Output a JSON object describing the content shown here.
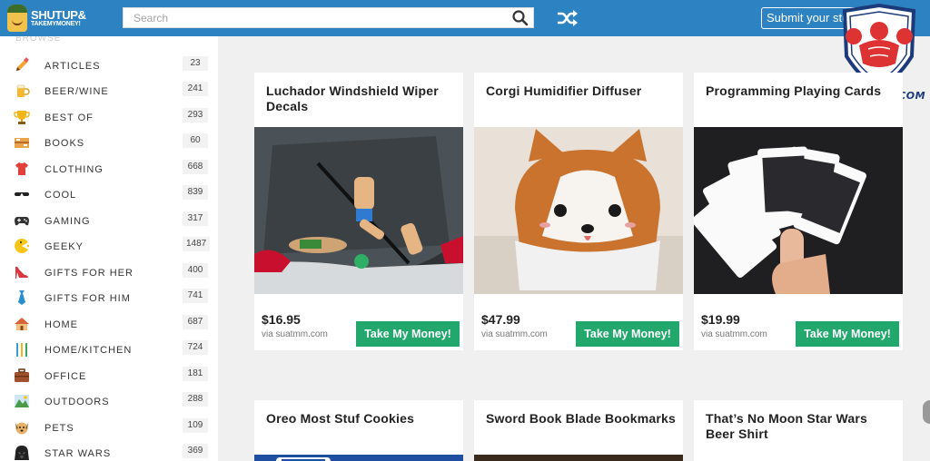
{
  "header": {
    "logo_main": "SHUTUP&",
    "logo_sub": "TAKEMYMONEY!",
    "search_placeholder": "Search",
    "submit_label": "Submit your stuff!"
  },
  "watermark": {
    "text": "GOOWHEE.COM"
  },
  "sidebar": {
    "heading": "BROWSE",
    "categories": [
      {
        "label": "ARTICLES",
        "count": "23",
        "icon": "pencil-icon"
      },
      {
        "label": "BEER/WINE",
        "count": "241",
        "icon": "beer-icon"
      },
      {
        "label": "BEST OF",
        "count": "293",
        "icon": "trophy-icon"
      },
      {
        "label": "BOOKS",
        "count": "60",
        "icon": "books-icon"
      },
      {
        "label": "CLOTHING",
        "count": "668",
        "icon": "shirt-icon"
      },
      {
        "label": "COOL",
        "count": "839",
        "icon": "sunglasses-icon"
      },
      {
        "label": "GAMING",
        "count": "317",
        "icon": "gamepad-icon"
      },
      {
        "label": "GEEKY",
        "count": "1487",
        "icon": "pacman-icon"
      },
      {
        "label": "GIFTS FOR HER",
        "count": "400",
        "icon": "heel-icon"
      },
      {
        "label": "GIFTS FOR HIM",
        "count": "741",
        "icon": "tie-icon"
      },
      {
        "label": "HOME",
        "count": "687",
        "icon": "house-icon"
      },
      {
        "label": "HOME/KITCHEN",
        "count": "724",
        "icon": "utensils-icon"
      },
      {
        "label": "OFFICE",
        "count": "181",
        "icon": "briefcase-icon"
      },
      {
        "label": "OUTDOORS",
        "count": "288",
        "icon": "mountain-icon"
      },
      {
        "label": "PETS",
        "count": "109",
        "icon": "dog-icon"
      },
      {
        "label": "STAR WARS",
        "count": "369",
        "icon": "darth-vader-icon"
      }
    ]
  },
  "products": [
    {
      "title": "Luchador Windshield Wiper Decals",
      "price": "$16.95",
      "via": "via suatmm.com",
      "buy_label": "Take My Money!"
    },
    {
      "title": "Corgi Humidifier Diffuser",
      "price": "$47.99",
      "via": "via suatmm.com",
      "buy_label": "Take My Money!"
    },
    {
      "title": "Programming Playing Cards",
      "price": "$19.99",
      "via": "via suatmm.com",
      "buy_label": "Take My Money!"
    },
    {
      "title": "Oreo Most Stuf Cookies"
    },
    {
      "title": "Sword Book Blade Bookmarks"
    },
    {
      "title": "That’s No Moon Star Wars Beer Shirt"
    }
  ],
  "colors": {
    "header": "#2d83c2",
    "buy_button": "#22a86d",
    "page_bg": "#f0f0f0"
  }
}
